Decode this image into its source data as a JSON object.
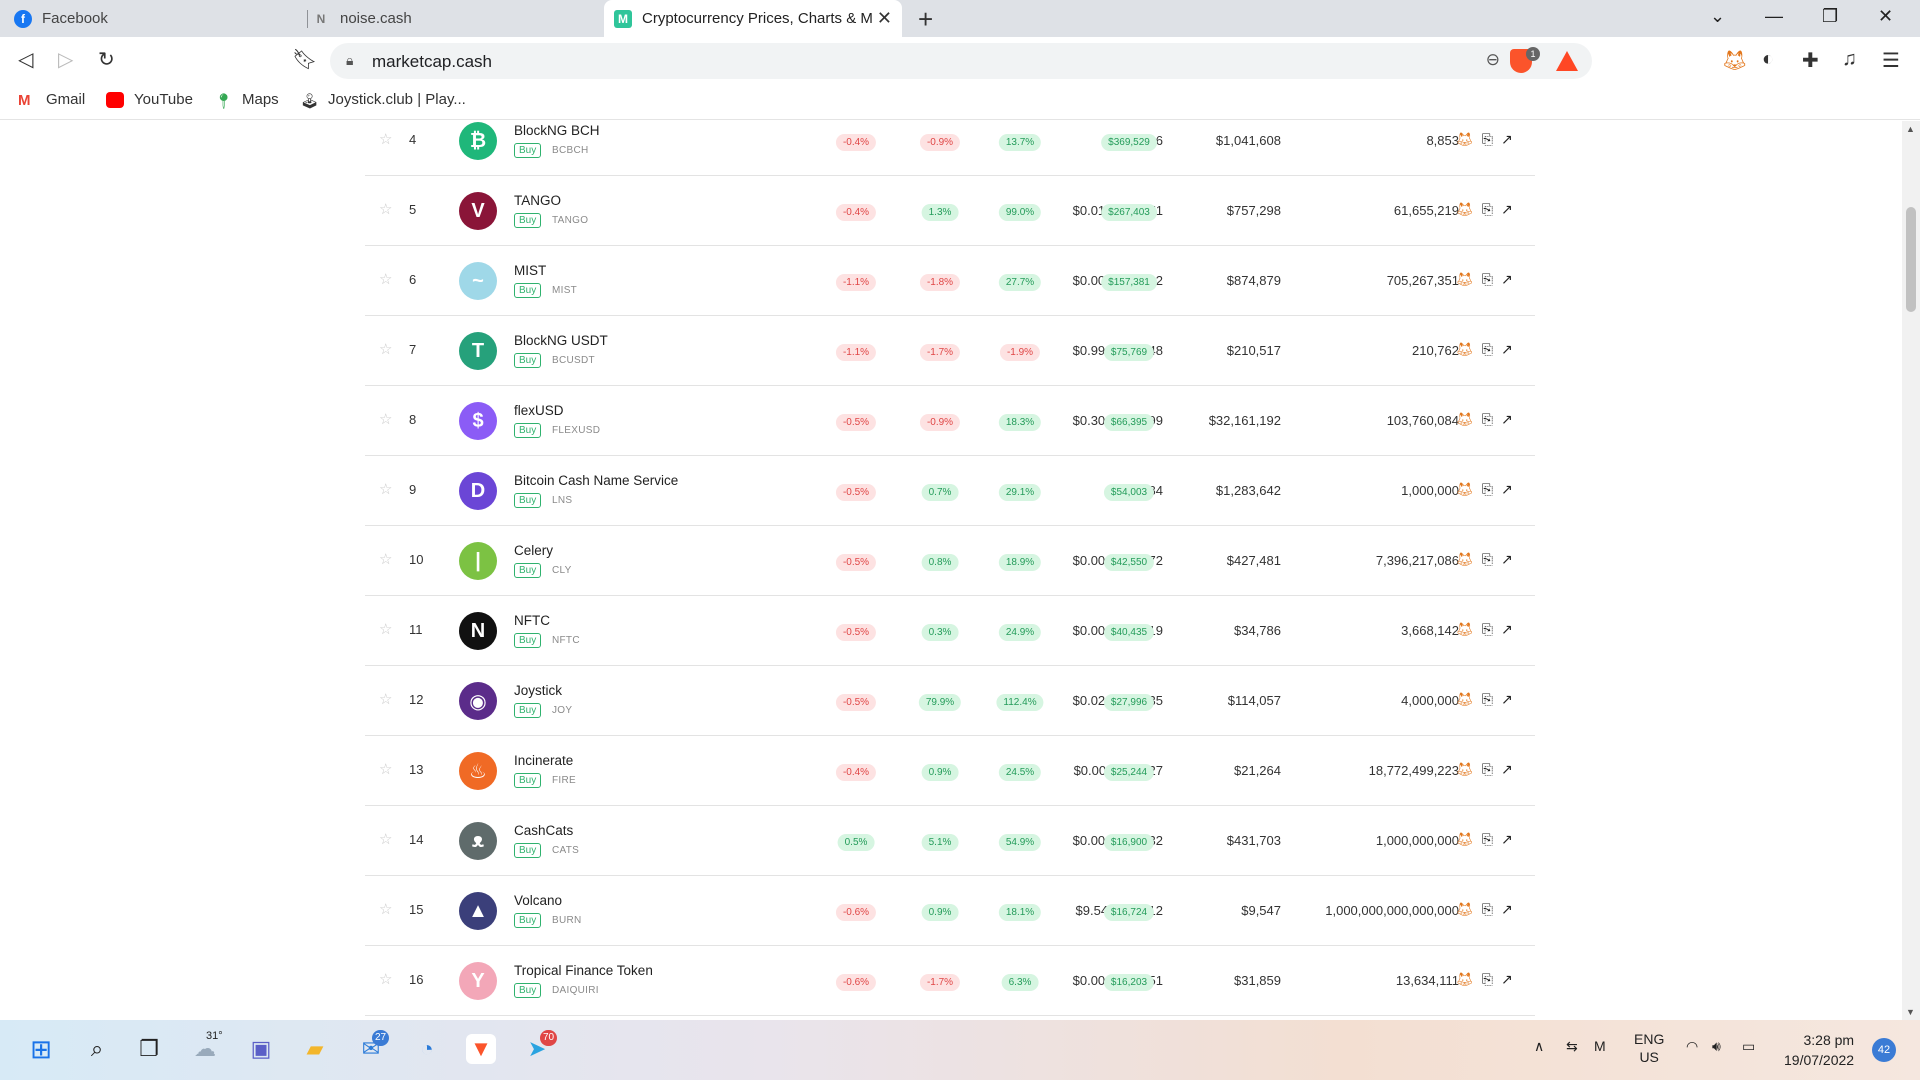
{
  "browser": {
    "tabs": [
      {
        "title": "Facebook"
      },
      {
        "title": "noise.cash"
      },
      {
        "title": "Cryptocurrency Prices, Charts & M"
      }
    ],
    "url": "marketcap.cash",
    "shield_count": "1",
    "new_tab": "+"
  },
  "bookmarks": [
    {
      "label": "Gmail"
    },
    {
      "label": "YouTube"
    },
    {
      "label": "Maps"
    },
    {
      "label": "Joystick.club | Play..."
    }
  ],
  "table": {
    "buy_label": "Buy",
    "rows": [
      {
        "rank": "4",
        "name": "BlockNG BCH",
        "symbol": "BCBCH",
        "price": "$117.66",
        "c1": "-0.4%",
        "c2": "-0.9%",
        "c3": "13.7%",
        "volume": "$369,529",
        "mcap": "$1,041,608",
        "supply": "8,853",
        "logo_color": "#1fb77a",
        "logo_glyph": "₿"
      },
      {
        "rank": "5",
        "name": "TANGO",
        "symbol": "TANGO",
        "price": "$0.0122827871",
        "c1": "-0.4%",
        "c2": "1.3%",
        "c3": "99.0%",
        "volume": "$267,403",
        "mcap": "$757,298",
        "supply": "61,655,219",
        "logo_color": "#8a1538",
        "logo_glyph": "V"
      },
      {
        "rank": "6",
        "name": "MIST",
        "symbol": "MIST",
        "price": "$0.0012404922",
        "c1": "-1.1%",
        "c2": "-1.8%",
        "c3": "27.7%",
        "volume": "$157,381",
        "mcap": "$874,879",
        "supply": "705,267,351",
        "logo_color": "#9fd8e8",
        "logo_glyph": "~"
      },
      {
        "rank": "7",
        "name": "BlockNG USDT",
        "symbol": "BCUSDT",
        "price": "$0.9988353648",
        "c1": "-1.1%",
        "c2": "-1.7%",
        "c3": "-1.9%",
        "volume": "$75,769",
        "mcap": "$210,517",
        "supply": "210,762",
        "logo_color": "#26a17b",
        "logo_glyph": "T"
      },
      {
        "rank": "8",
        "name": "flexUSD",
        "symbol": "FLEXUSD",
        "price": "$0.3099572699",
        "c1": "-0.5%",
        "c2": "-0.9%",
        "c3": "18.3%",
        "volume": "$66,395",
        "mcap": "$32,161,192",
        "supply": "103,760,084",
        "logo_color": "#8b5cf6",
        "logo_glyph": "$"
      },
      {
        "rank": "9",
        "name": "Bitcoin Cash Name Service",
        "symbol": "LNS",
        "price": "$1.284",
        "c1": "-0.5%",
        "c2": "0.7%",
        "c3": "29.1%",
        "volume": "$54,003",
        "mcap": "$1,283,642",
        "supply": "1,000,000",
        "logo_color": "#6b46d6",
        "logo_glyph": "D"
      },
      {
        "rank": "10",
        "name": "Celery",
        "symbol": "CLY",
        "price": "$0.0000577972",
        "c1": "-0.5%",
        "c2": "0.8%",
        "c3": "18.9%",
        "volume": "$42,550",
        "mcap": "$427,481",
        "supply": "7,396,217,086",
        "logo_color": "#7cc243",
        "logo_glyph": "|"
      },
      {
        "rank": "11",
        "name": "NFTC",
        "symbol": "NFTC",
        "price": "$0.0094833819",
        "c1": "-0.5%",
        "c2": "0.3%",
        "c3": "24.9%",
        "volume": "$40,435",
        "mcap": "$34,786",
        "supply": "3,668,142",
        "logo_color": "#111111",
        "logo_glyph": "N"
      },
      {
        "rank": "12",
        "name": "Joystick",
        "symbol": "JOY",
        "price": "$0.0285143435",
        "c1": "-0.5%",
        "c2": "79.9%",
        "c3": "112.4%",
        "volume": "$27,996",
        "mcap": "$114,057",
        "supply": "4,000,000",
        "logo_color": "#5b2c8a",
        "logo_glyph": "◉"
      },
      {
        "rank": "13",
        "name": "Incinerate",
        "symbol": "FIRE",
        "price": "$0.0000011327",
        "c1": "-0.4%",
        "c2": "0.9%",
        "c3": "24.5%",
        "volume": "$25,244",
        "mcap": "$21,264",
        "supply": "18,772,499,223",
        "logo_color": "#f06a25",
        "logo_glyph": "♨"
      },
      {
        "rank": "14",
        "name": "CashCats",
        "symbol": "CATS",
        "price": "$0.0004317032",
        "c1": "0.5%",
        "c2": "5.1%",
        "c3": "54.9%",
        "volume": "$16,900",
        "mcap": "$431,703",
        "supply": "1,000,000,000",
        "logo_color": "#5f6b6b",
        "logo_glyph": "ᴥ"
      },
      {
        "rank": "15",
        "name": "Volcano",
        "symbol": "BURN",
        "price": "$9.547239e-12",
        "c1": "-0.6%",
        "c2": "0.9%",
        "c3": "18.1%",
        "volume": "$16,724",
        "mcap": "$9,547",
        "supply": "1,000,000,000,000,000",
        "logo_color": "#3b3f7a",
        "logo_glyph": "▲"
      },
      {
        "rank": "16",
        "name": "Tropical Finance Token",
        "symbol": "DAIQUIRI",
        "price": "$0.0023366951",
        "c1": "-0.6%",
        "c2": "-1.7%",
        "c3": "6.3%",
        "volume": "$16,203",
        "mcap": "$31,859",
        "supply": "13,634,111",
        "logo_color": "#f3a7b8",
        "logo_glyph": "Y"
      }
    ]
  },
  "taskbar": {
    "weather_temp": "31°",
    "mail_badge": "27",
    "telegram_badge": "70",
    "lang_top": "ENG",
    "lang_bottom": "US",
    "time": "3:28 pm",
    "date": "19/07/2022",
    "notifications": "42"
  }
}
